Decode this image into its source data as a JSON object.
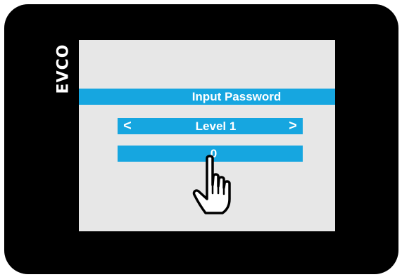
{
  "device": {
    "brand": "EVCO"
  },
  "screen": {
    "title": "Input Password",
    "level_label": "Level 1",
    "left_arrow": "<",
    "right_arrow": ">",
    "password_value": "0"
  },
  "icons": {
    "cursor": "pointing-hand-icon"
  },
  "colors": {
    "accent": "#16a6e0",
    "screen_bg": "#e7e7e7",
    "bezel": "#000000"
  }
}
